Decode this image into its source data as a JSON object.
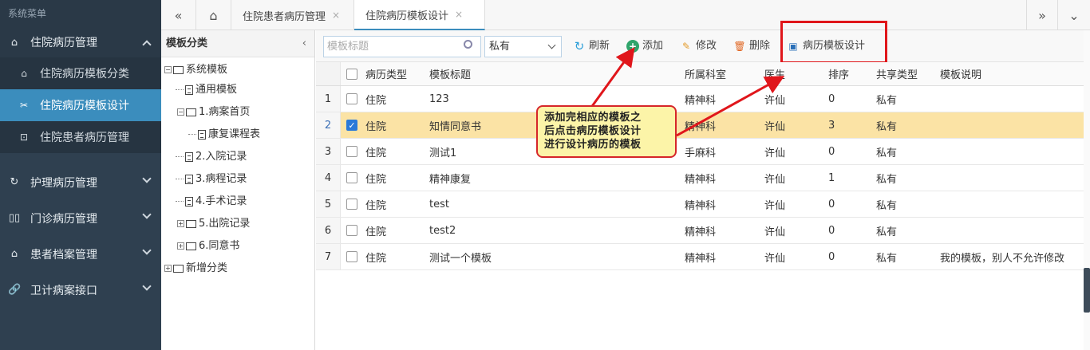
{
  "sidebar": {
    "title": "系统菜单",
    "groups": [
      {
        "label": "住院病历管理",
        "icon": "home-icon",
        "expanded": true,
        "items": [
          {
            "label": "住院病历模板分类",
            "icon": "home-icon"
          },
          {
            "label": "住院病历模板设计",
            "icon": "scissors-icon"
          },
          {
            "label": "住院患者病历管理",
            "icon": "lock-icon"
          }
        ]
      },
      {
        "label": "护理病历管理",
        "icon": "refresh-icon"
      },
      {
        "label": "门诊病历管理",
        "icon": "columns-icon"
      },
      {
        "label": "患者档案管理",
        "icon": "home-icon"
      },
      {
        "label": "卫计病案接口",
        "icon": "link-icon"
      }
    ],
    "active_color": "#3b8dbd"
  },
  "tabs": [
    {
      "label": "住院患者病历管理",
      "close": "×"
    },
    {
      "label": "住院病历模板设计",
      "close": "×"
    }
  ],
  "tree": {
    "title": "模板分类",
    "collapse": "‹",
    "nodes": [
      {
        "label": "系统模板"
      },
      {
        "label": "通用模板"
      },
      {
        "label": "1.病案首页"
      },
      {
        "label": "康复课程表"
      },
      {
        "label": "2.入院记录"
      },
      {
        "label": "3.病程记录"
      },
      {
        "label": "4.手术记录"
      },
      {
        "label": "5.出院记录"
      },
      {
        "label": "6.同意书"
      },
      {
        "label": "新增分类"
      }
    ]
  },
  "toolbar": {
    "search_placeholder": "模板标题",
    "share_select": "私有",
    "refresh": "刷新",
    "add": "添加",
    "edit": "修改",
    "delete": "删除",
    "design": "病历模板设计"
  },
  "table": {
    "columns": [
      "病历类型",
      "模板标题",
      "所属科室",
      "医生",
      "排序",
      "共享类型",
      "模板说明"
    ],
    "rows": [
      {
        "n": "1",
        "type": "住院",
        "title": "123",
        "dept": "精神科",
        "doctor": "许仙",
        "order": "0",
        "share": "私有",
        "desc": "",
        "checked": false
      },
      {
        "n": "2",
        "type": "住院",
        "title": "知情同意书",
        "dept": "精神科",
        "doctor": "许仙",
        "order": "3",
        "share": "私有",
        "desc": "",
        "checked": true
      },
      {
        "n": "3",
        "type": "住院",
        "title": "测试1",
        "dept": "手麻科",
        "doctor": "许仙",
        "order": "0",
        "share": "私有",
        "desc": "",
        "checked": false
      },
      {
        "n": "4",
        "type": "住院",
        "title": "精神康复",
        "dept": "精神科",
        "doctor": "许仙",
        "order": "1",
        "share": "私有",
        "desc": "",
        "checked": false
      },
      {
        "n": "5",
        "type": "住院",
        "title": "test",
        "dept": "精神科",
        "doctor": "许仙",
        "order": "0",
        "share": "私有",
        "desc": "",
        "checked": false
      },
      {
        "n": "6",
        "type": "住院",
        "title": "test2",
        "dept": "精神科",
        "doctor": "许仙",
        "order": "0",
        "share": "私有",
        "desc": "",
        "checked": false
      },
      {
        "n": "7",
        "type": "住院",
        "title": "测试一个模板",
        "dept": "精神科",
        "doctor": "许仙",
        "order": "0",
        "share": "私有",
        "desc": "我的模板，别人不允许修改",
        "checked": false
      }
    ],
    "selected_row_color": "#fbe3a5"
  },
  "annotation": {
    "lines": [
      "添加完相应的模板之",
      "后点击病历模板设计",
      "进行设计病历的模板"
    ],
    "color": "#e0161b"
  }
}
